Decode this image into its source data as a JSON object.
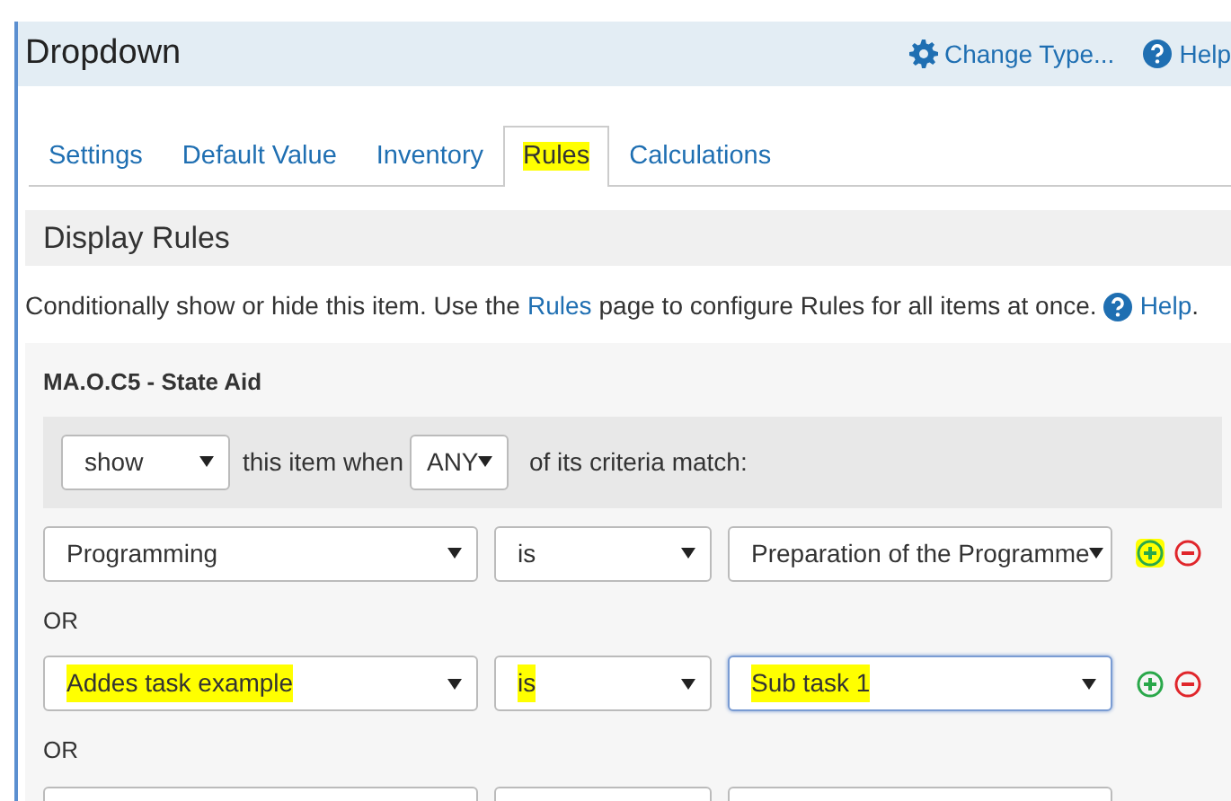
{
  "header": {
    "title": "Dropdown",
    "change_type": "Change Type...",
    "help": "Help"
  },
  "tabs": [
    {
      "label": "Settings",
      "selected": false,
      "highlighted": false
    },
    {
      "label": "Default Value",
      "selected": false,
      "highlighted": false
    },
    {
      "label": "Inventory",
      "selected": false,
      "highlighted": false
    },
    {
      "label": "Rules",
      "selected": true,
      "highlighted": true
    },
    {
      "label": "Calculations",
      "selected": false,
      "highlighted": false
    }
  ],
  "section_title": "Display Rules",
  "description": {
    "before": "Conditionally show or hide this item. Use the",
    "link": "Rules",
    "after": "page to configure Rules for all items at once.",
    "help": "Help",
    "end": "."
  },
  "rule_group": {
    "title": "MA.O.C5 - State Aid",
    "action": "show",
    "middle": "this item when",
    "match": "ANY",
    "after": "of its criteria match:"
  },
  "conditions": [
    {
      "field": "Programming",
      "operator": "is",
      "value": "Preparation of the Programme",
      "highlighted": false,
      "plus_highlighted": true,
      "focused": false,
      "kind": "rule"
    },
    {
      "field": "Addes task example",
      "operator": "is",
      "value": "Sub task 1",
      "highlighted": true,
      "plus_highlighted": false,
      "focused": true,
      "kind": "rule"
    },
    {
      "kind": "blank"
    }
  ],
  "separators": [
    "OR",
    "OR"
  ]
}
